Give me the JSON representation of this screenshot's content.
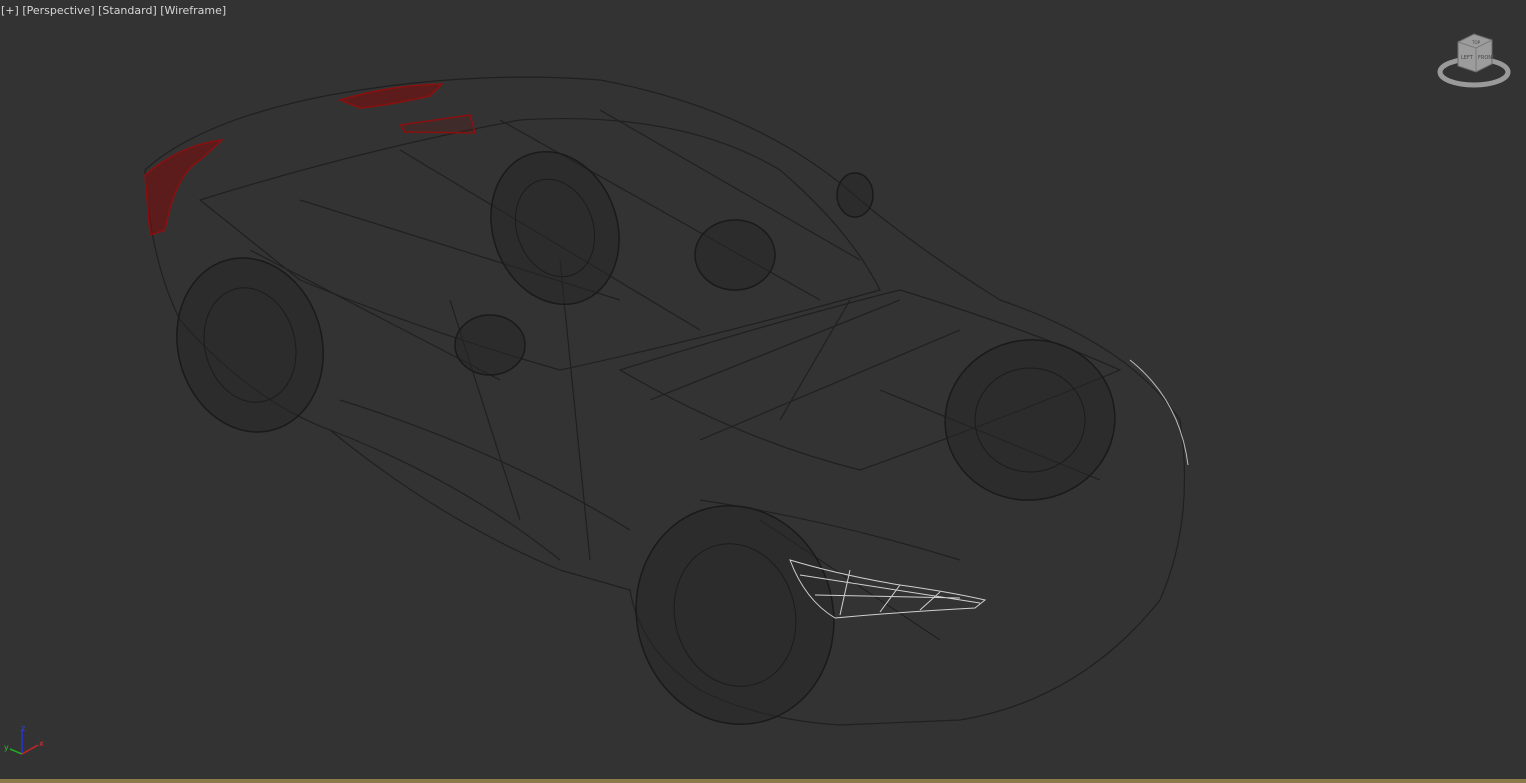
{
  "viewport": {
    "menu_plus": "[+]",
    "view": "[Perspective]",
    "shading_preset": "[Standard]",
    "display_mode": "[Wireframe]"
  },
  "viewcube": {
    "faces": [
      "TOP",
      "LEFT",
      "FRONT"
    ]
  },
  "axis_gizmo": {
    "x": "x",
    "y": "y",
    "z": "z"
  },
  "colors": {
    "background": "#333333",
    "wire": "#1f1f1f",
    "taillight": "#8a1010",
    "headlight": "#d8d8d8"
  }
}
